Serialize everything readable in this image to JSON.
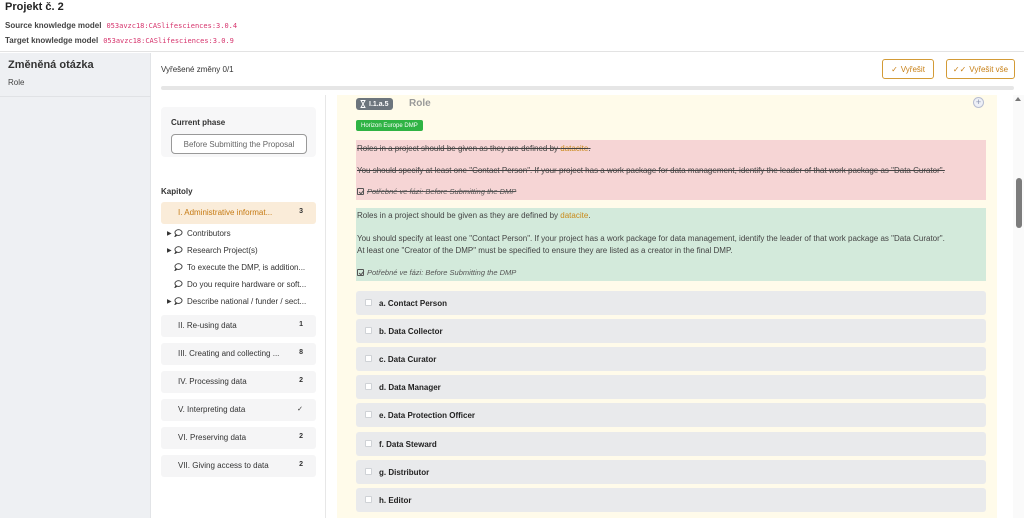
{
  "header": {
    "project_title": "Projekt č. 2",
    "source_label": "Source knowledge model",
    "source_value": "053avzc18:CASlifesciences:3.0.4",
    "target_label": "Target knowledge model",
    "target_value": "053avzc18:CASlifesciences:3.0.9"
  },
  "sidebar": {
    "title": "Změněná otázka",
    "subtitle": "Role"
  },
  "toolbar": {
    "resolved_label": "Vyřešené změny 0/1",
    "resolve_label": "Vyřešit",
    "resolve_all_label": "Vyřešit vše",
    "progress": 0
  },
  "phase": {
    "label": "Current phase",
    "value": "Before Submitting the Proposal"
  },
  "chapters": {
    "heading": "Kapitoly",
    "items": [
      {
        "label": "I. Administrative informat...",
        "count": "3"
      },
      {
        "label": "II. Re-using data",
        "count": "1"
      },
      {
        "label": "III. Creating and collecting ...",
        "count": "8"
      },
      {
        "label": "IV. Processing data",
        "count": "2"
      },
      {
        "label": "V. Interpreting data",
        "count": "✓"
      },
      {
        "label": "VI. Preserving data",
        "count": "2"
      },
      {
        "label": "VII. Giving access to data",
        "count": "2"
      }
    ],
    "subitems": [
      {
        "label": "Contributors"
      },
      {
        "label": "Research Project(s)"
      },
      {
        "label": "To execute the DMP, is addition..."
      },
      {
        "label": "Do you require hardware or soft..."
      },
      {
        "label": "Describe national / funder / sect..."
      }
    ]
  },
  "question": {
    "badge": "I.1.a.5",
    "title": "Role",
    "tag": "Horizon Europe DMP",
    "old": {
      "line1_prefix": "Roles in a project should be given as they are defined by ",
      "line1_link": "datacite",
      "line1_suffix": ".",
      "line2": "You should specify at least one \"Contact Person\". If your project has a work package for data management, identify the leader of that work package as \"Data Curator\".",
      "required_prefix": "Potřebné ve fázi: ",
      "required_phase": "Before Submitting the DMP"
    },
    "new": {
      "line1_prefix": "Roles in a project should be given as they are defined by ",
      "line1_link": "datacite",
      "line1_suffix": ".",
      "line2": "You should specify at least one \"Contact Person\". If your project has a work package for data management, identify the leader of that work package as \"Data Curator\".",
      "line3": "At least one \"Creator of the DMP\" must be specified to ensure they are listed as a creator in the final DMP.",
      "required_prefix": "Potřebné ve fázi: ",
      "required_phase": "Before Submitting the DMP"
    },
    "options": [
      {
        "label": "a. Contact Person"
      },
      {
        "label": "b. Data Collector"
      },
      {
        "label": "c. Data Curator"
      },
      {
        "label": "d. Data Manager"
      },
      {
        "label": "e. Data Protection Officer"
      },
      {
        "label": "f. Data Steward"
      },
      {
        "label": "g. Distributor"
      },
      {
        "label": "h. Editor"
      }
    ]
  }
}
